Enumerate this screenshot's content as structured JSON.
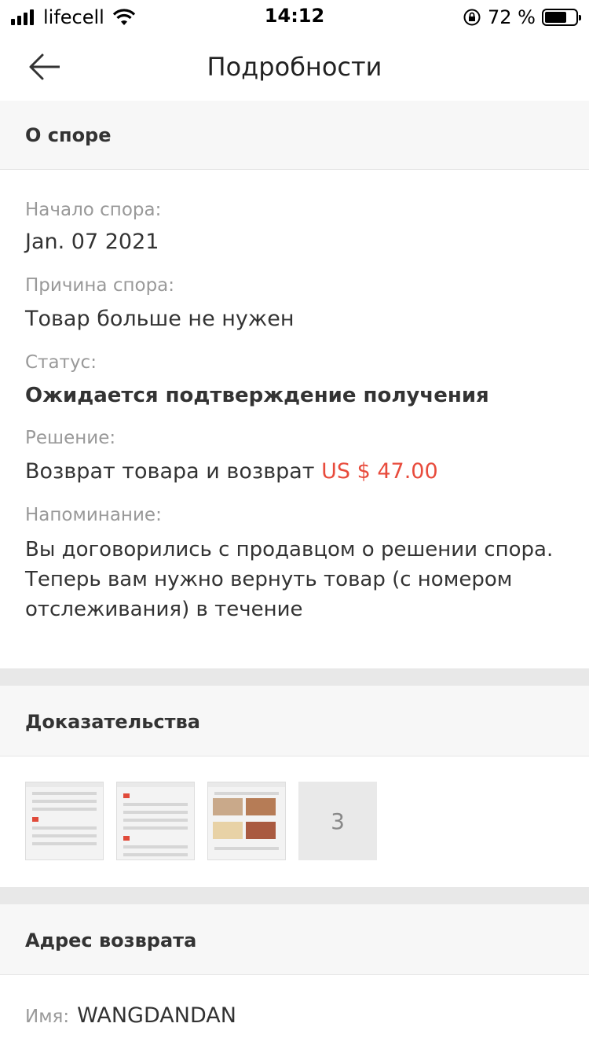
{
  "status_bar": {
    "carrier": "lifecell",
    "time": "14:12",
    "battery_text": "72 %",
    "battery_level": 0.72
  },
  "nav": {
    "title": "Подробности"
  },
  "dispute": {
    "header": "О споре",
    "start_label": "Начало спора:",
    "start_value": "Jan. 07 2021",
    "reason_label": "Причина спора:",
    "reason_value": "Товар больше не нужен",
    "status_label": "Статус:",
    "status_value": "Ожидается подтверждение получения",
    "solution_label": "Решение:",
    "solution_value": "Возврат товара и возврат",
    "solution_amount": "US $ 47.00",
    "reminder_label": "Напоминание:",
    "reminder_value": "Вы договорились с продавцом о решении спора. Теперь вам нужно вернуть товар (с номером отслеживания) в течение"
  },
  "evidence": {
    "header": "Доказательства",
    "more_count": "3"
  },
  "return_address": {
    "header": "Адрес возврата",
    "name_label": "Имя:",
    "name_value": "WANGDANDAN"
  },
  "colors": {
    "accent_price": "#e84b3c",
    "section_bg": "#f7f7f7",
    "gap_bg": "#e8e8e8"
  }
}
